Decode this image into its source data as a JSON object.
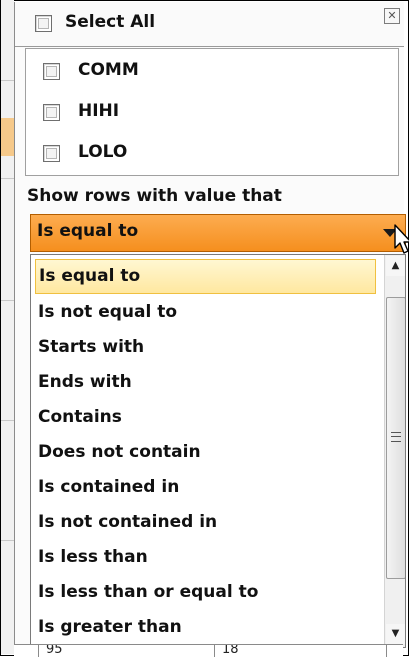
{
  "filter": {
    "select_all_label": "Select All",
    "close_icon": "close-icon",
    "close_glyph": "✕",
    "values": [
      {
        "label": "COMM",
        "checked": false
      },
      {
        "label": "HIHI",
        "checked": false
      },
      {
        "label": "LOLO",
        "checked": false
      }
    ]
  },
  "condition": {
    "label": "Show rows with value that",
    "selected": "Is equal to",
    "options": [
      "Is equal to",
      "Is not equal to",
      "Starts with",
      "Ends with",
      "Contains",
      "Does not contain",
      "Is contained in",
      "Is not contained in",
      "Is less than",
      "Is less than or equal to",
      "Is greater than"
    ]
  },
  "scrollbar": {
    "up_glyph": "▲",
    "down_glyph": "▼"
  },
  "grid_peek": {
    "cells": [
      "95",
      "18"
    ]
  },
  "colors": {
    "dropdown_accent": "#f58f1e",
    "highlight": "#ffe8a0"
  }
}
